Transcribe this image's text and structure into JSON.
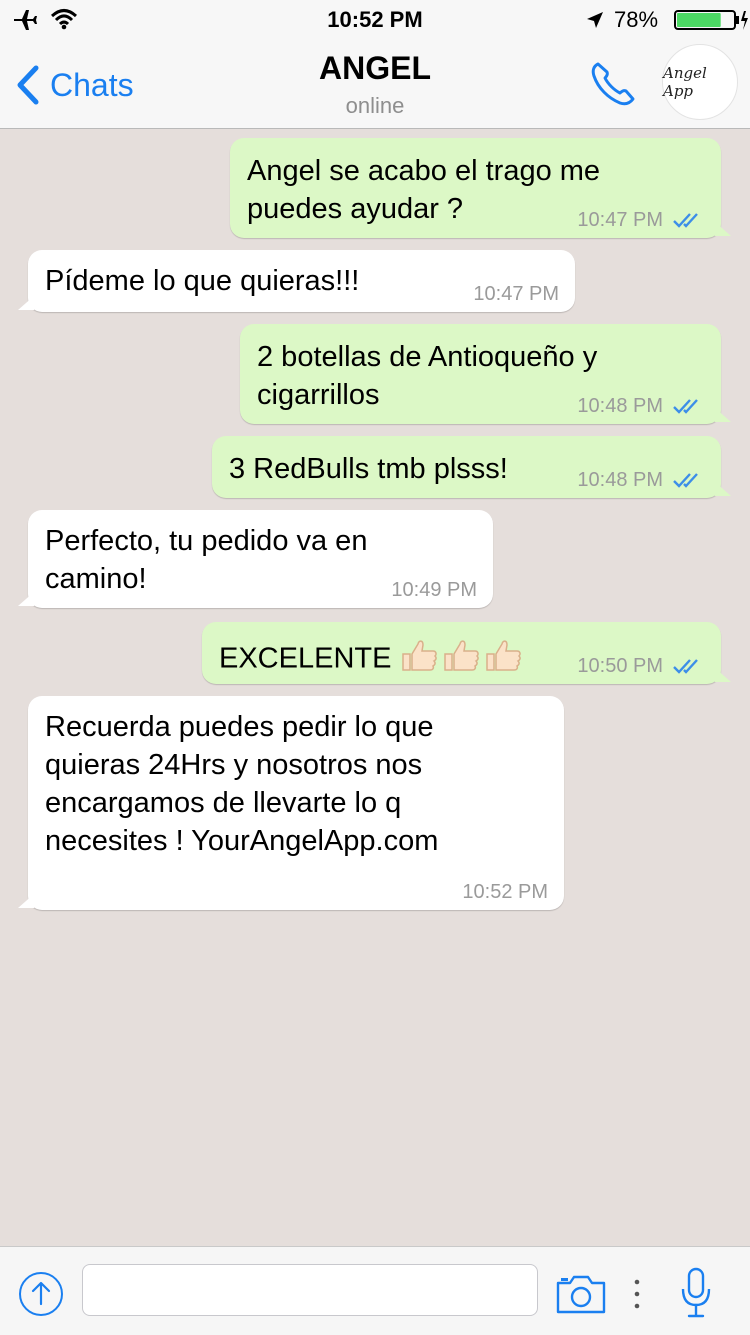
{
  "status_bar": {
    "time": "10:52 PM",
    "battery_percent": "78%",
    "battery_level": 0.78,
    "icons": [
      "airplane-mode-icon",
      "wifi-icon",
      "location-arrow-icon",
      "battery-icon",
      "charging-bolt-icon"
    ]
  },
  "nav": {
    "back_label": "Chats",
    "title": "ANGEL",
    "subtitle": "online",
    "avatar_text": "Angel App"
  },
  "messages": [
    {
      "direction": "out",
      "text": "Angel se acabo el trago me puedes ayudar ?",
      "time": "10:47 PM",
      "read": true
    },
    {
      "direction": "in",
      "text": "Pídeme lo que quieras!!!",
      "time": "10:47 PM"
    },
    {
      "direction": "out",
      "text": "2 botellas de Antioqueño y cigarrillos",
      "time": "10:48 PM",
      "read": true
    },
    {
      "direction": "out",
      "text": "3 RedBulls tmb plsss!",
      "time": "10:48 PM",
      "read": true
    },
    {
      "direction": "in",
      "text": "Perfecto, tu pedido va en camino!",
      "time": "10:49 PM"
    },
    {
      "direction": "out",
      "text": "EXCELENTE",
      "emoji": "thumbs-up x3",
      "time": "10:50 PM",
      "read": true
    },
    {
      "direction": "in",
      "text": "Recuerda puedes pedir lo que quieras 24Hrs y nosotros nos encargamos de llevarte lo q necesites ! YourAngelApp.com",
      "time": "10:52 PM"
    }
  ],
  "input_bar": {
    "placeholder": "",
    "icons": [
      "share-icon",
      "camera-icon",
      "more-icon",
      "microphone-icon"
    ]
  },
  "colors": {
    "background": "#e5dedb",
    "outgoing_bubble": "#dcf8c6",
    "incoming_bubble": "#ffffff",
    "accent": "#1a7ff0",
    "read_ticks": "#3d8ee8"
  }
}
